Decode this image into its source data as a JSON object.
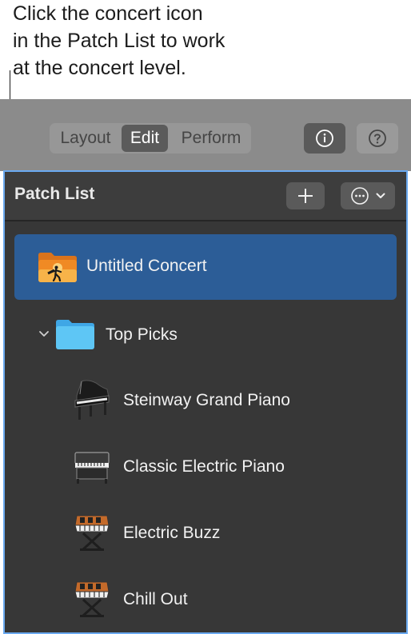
{
  "callout": {
    "line1": "Click the concert icon",
    "line2": "in the Patch List to work",
    "line3": "at the concert level."
  },
  "toolbar": {
    "tabs": [
      {
        "label": "Layout"
      },
      {
        "label": "Edit"
      },
      {
        "label": "Perform"
      }
    ],
    "selected_tab": "Edit",
    "info_icon": "info-icon",
    "help_icon": "help-icon"
  },
  "patch_list": {
    "title": "Patch List",
    "add_icon": "plus-icon",
    "more_icon": "ellipsis-circle-icon",
    "items": [
      {
        "label": "Untitled Concert",
        "icon": "concert-folder-icon",
        "selected": true
      },
      {
        "label": "Top Picks",
        "icon": "folder-icon",
        "expanded": true
      },
      {
        "label": "Steinway Grand Piano",
        "icon": "grand-piano-icon"
      },
      {
        "label": "Classic Electric Piano",
        "icon": "electric-piano-icon"
      },
      {
        "label": "Electric Buzz",
        "icon": "synth-keyboard-icon"
      },
      {
        "label": "Chill Out",
        "icon": "synth-keyboard-icon"
      }
    ]
  },
  "colors": {
    "selection": "#2c5d97",
    "panel_bg": "#373737",
    "focus_ring": "#6aa9f0",
    "folder_blue": "#5ec6f5",
    "concert_orange": "#f08a24"
  }
}
